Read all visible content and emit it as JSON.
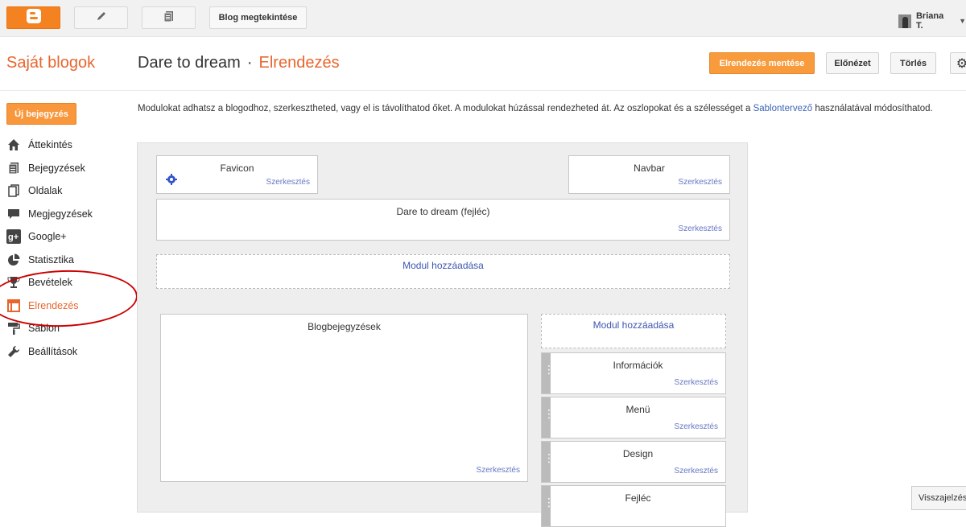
{
  "topbar": {
    "blogger_icon": "blogger-logo-icon",
    "pencil_icon": "pencil-icon",
    "pages_icon": "posts-list-icon",
    "view_blog_label": "Blog megtekintése",
    "user_name": "Briana T."
  },
  "header": {
    "my_blogs": "Saját blogok",
    "blog_name": "Dare to dream",
    "separator": "·",
    "section": "Elrendezés",
    "save_label": "Elrendezés mentése",
    "preview_label": "Előnézet",
    "delete_label": "Törlés",
    "gear_icon": "gear-icon"
  },
  "sidebar": {
    "new_post": "Új bejegyzés",
    "items": [
      {
        "label": "Áttekintés",
        "icon": "home-icon"
      },
      {
        "label": "Bejegyzések",
        "icon": "posts-icon"
      },
      {
        "label": "Oldalak",
        "icon": "pages-icon"
      },
      {
        "label": "Megjegyzések",
        "icon": "comment-icon"
      },
      {
        "label": "Google+",
        "icon": "google-plus-icon"
      },
      {
        "label": "Statisztika",
        "icon": "pie-chart-icon"
      },
      {
        "label": "Bevételek",
        "icon": "trophy-icon"
      },
      {
        "label": "Elrendezés",
        "icon": "layout-icon"
      },
      {
        "label": "Sablon",
        "icon": "paint-roller-icon"
      },
      {
        "label": "Beállítások",
        "icon": "wrench-icon"
      }
    ]
  },
  "description": {
    "text_before": "Modulokat adhatsz a blogodhoz, szerkesztheted, vagy el is távolíthatod őket. A modulokat húzással rendezheted át. Az oszlopokat és a szélességet a ",
    "link": "Sablontervező",
    "text_after": " használatával módosíthatod."
  },
  "layout": {
    "favicon": {
      "title": "Favicon",
      "edit": "Szerkesztés"
    },
    "navbar": {
      "title": "Navbar",
      "edit": "Szerkesztés"
    },
    "header": {
      "title": "Dare to dream (fejléc)",
      "edit": "Szerkesztés"
    },
    "add_module_top": "Modul hozzáadása",
    "main": {
      "title": "Blogbejegyzések",
      "edit": "Szerkesztés"
    },
    "add_module_side": "Modul hozzáadása",
    "side_gadgets": [
      {
        "title": "Információk",
        "edit": "Szerkesztés"
      },
      {
        "title": "Menü",
        "edit": "Szerkesztés"
      },
      {
        "title": "Design",
        "edit": "Szerkesztés"
      },
      {
        "title": "Fejléc",
        "edit": ""
      }
    ]
  },
  "feedback": "Visszajelzés"
}
